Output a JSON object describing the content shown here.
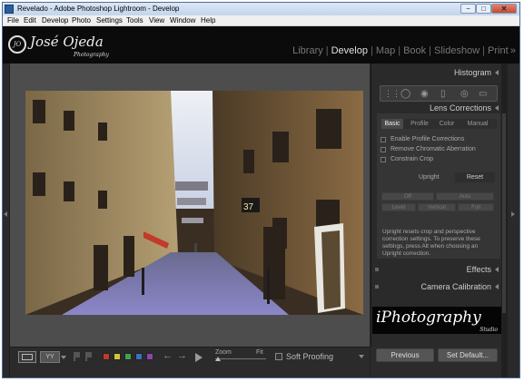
{
  "window": {
    "title": "Revelado - Adobe Photoshop Lightroom - Develop",
    "minimize": "−",
    "maximize": "□",
    "close": "✕"
  },
  "menu": [
    "File",
    "Edit",
    "Develop",
    "Photo",
    "Settings",
    "Tools",
    "View",
    "Window",
    "Help"
  ],
  "identity": {
    "logo_initials": "JO",
    "name": "José Ojeda",
    "tagline": "Photography"
  },
  "modules": [
    {
      "label": "Library",
      "active": false
    },
    {
      "label": "Develop",
      "active": true
    },
    {
      "label": "Map",
      "active": false
    },
    {
      "label": "Book",
      "active": false
    },
    {
      "label": "Slideshow",
      "active": false
    },
    {
      "label": "Print",
      "active": false
    }
  ],
  "modules_more": "»",
  "photo": {
    "street_number": "37"
  },
  "toolbar": {
    "view_compare": "YY",
    "color_labels": [
      "#c0392b",
      "#d4c23a",
      "#3fa34d",
      "#3b6fc4",
      "#8e44ad"
    ],
    "prev": "←",
    "next": "→",
    "zoom_label": "Zoom",
    "zoom_fit": "Fit",
    "zoom_value": 0.05,
    "soft_proofing": "Soft Proofing"
  },
  "right_panel": {
    "histogram_title": "Histogram",
    "lens_title": "Lens Corrections",
    "tabs": [
      "Basic",
      "Profile",
      "Color",
      "Manual"
    ],
    "active_tab": "Basic",
    "checkboxes": [
      "Enable Profile Corrections",
      "Remove Chromatic Aberration",
      "Constrain Crop"
    ],
    "upright_label": "Upright",
    "reset_label": "Reset",
    "upright_buttons": [
      "Off",
      "Auto",
      "Level",
      "Vertical",
      "Full"
    ],
    "upright_desc": "Upright resets crop and perspective correction settings. To preserve these settings, press Alt when choosing an Upright correction.",
    "effects_title": "Effects",
    "camera_calibration_title": "Camera Calibration",
    "watermark_text": "iPhotography",
    "watermark_sub": "Studio"
  },
  "buttons": {
    "previous": "Previous",
    "set_default": "Set Default..."
  }
}
